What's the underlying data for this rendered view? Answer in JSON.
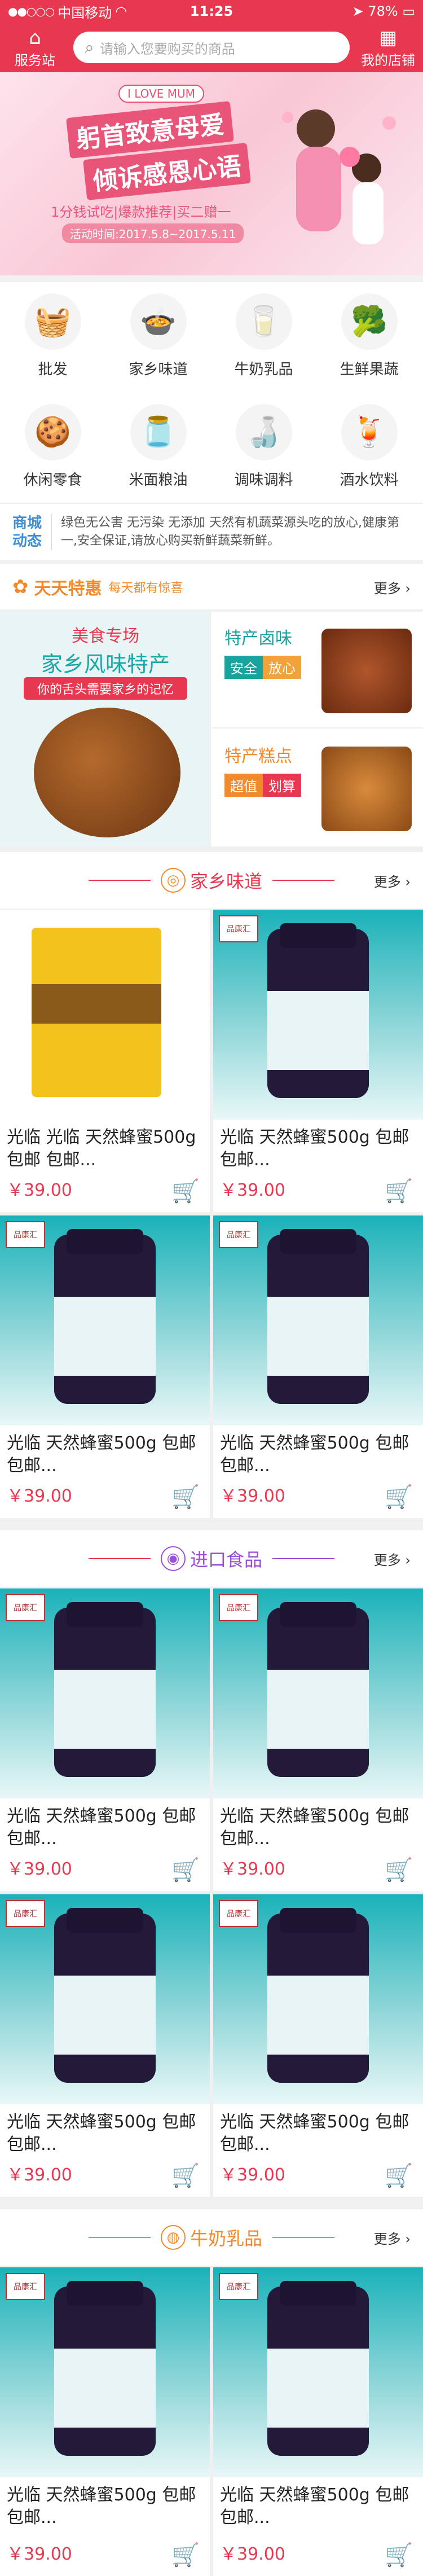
{
  "status_bar": {
    "carrier": "中国移动",
    "time": "11:25",
    "battery": "78%"
  },
  "top_nav": {
    "left_label": "服务站",
    "search_placeholder": "请输入您要购买的商品",
    "right_label": "我的店铺"
  },
  "banner": {
    "tag": "I LOVE MUM",
    "line1": "躬首致意母爱",
    "line2": "倾诉感恩心语",
    "promo": "1分钱试吃|爆款推荐|买二赠一",
    "date": "活动时间:2017.5.8~2017.5.11"
  },
  "categories": [
    {
      "label": "批发",
      "icon": "shopping-basket"
    },
    {
      "label": "家乡味道",
      "icon": "food-plate"
    },
    {
      "label": "牛奶乳品",
      "icon": "milk"
    },
    {
      "label": "生鲜果蔬",
      "icon": "vegetables"
    },
    {
      "label": "休闲零食",
      "icon": "snack-bag"
    },
    {
      "label": "米面粮油",
      "icon": "oil-bottle"
    },
    {
      "label": "调味调料",
      "icon": "sauce-bottle"
    },
    {
      "label": "酒水饮料",
      "icon": "drink"
    }
  ],
  "news": {
    "badge": "商城动态",
    "text": "绿色无公害 无污染 无添加 天然有机蔬菜源头吃的放心,健康第一,安全保证,请放心购买新鲜蔬菜新鲜。"
  },
  "daily_special": {
    "title": "天天特惠",
    "subtitle": "每天都有惊喜",
    "more": "更多"
  },
  "promo": {
    "main_line1": "美食专场",
    "main_line2": "家乡风味特产",
    "main_line3": "你的舌头需要家乡的记忆",
    "side1_title": "特产卤味",
    "side1_tag1": "安全",
    "side1_tag2": "放心",
    "side2_title": "特产糕点",
    "side2_tag1": "超值",
    "side2_tag2": "划算"
  },
  "sections": [
    {
      "title": "家乡味道",
      "more": "更多"
    },
    {
      "title": "进口食品",
      "more": "更多"
    },
    {
      "title": "牛奶乳品",
      "more": "更多"
    }
  ],
  "products": [
    {
      "name": "光临 光临 天然蜂蜜500g 包邮 包邮...",
      "price": "￥39.00",
      "image": "snack"
    },
    {
      "name": "光临 天然蜂蜜500g 包邮 包邮...",
      "price": "￥39.00",
      "image": "bottle"
    },
    {
      "name": "光临 天然蜂蜜500g 包邮 包邮...",
      "price": "￥39.00",
      "image": "bottle"
    },
    {
      "name": "光临 天然蜂蜜500g 包邮 包邮...",
      "price": "￥39.00",
      "image": "bottle"
    },
    {
      "name": "光临 天然蜂蜜500g 包邮 包邮...",
      "price": "￥39.00",
      "image": "bottle"
    },
    {
      "name": "光临 天然蜂蜜500g 包邮 包邮...",
      "price": "￥39.00",
      "image": "bottle"
    },
    {
      "name": "光临 天然蜂蜜500g 包邮 包邮...",
      "price": "￥39.00",
      "image": "bottle"
    },
    {
      "name": "光临 天然蜂蜜500g 包邮 包邮...",
      "price": "￥39.00",
      "image": "bottle"
    },
    {
      "name": "光临 天然蜂蜜500g 包邮 包邮...",
      "price": "￥39.00",
      "image": "bottle"
    },
    {
      "name": "光临 天然蜂蜜500g 包邮 包邮...",
      "price": "￥39.00",
      "image": "bottle"
    }
  ],
  "brand_logo_text": "品康汇",
  "colors": {
    "brand": "#e8384f",
    "accent": "#f08a2c",
    "teal": "#18a39f",
    "purple": "#9b4fd6"
  }
}
